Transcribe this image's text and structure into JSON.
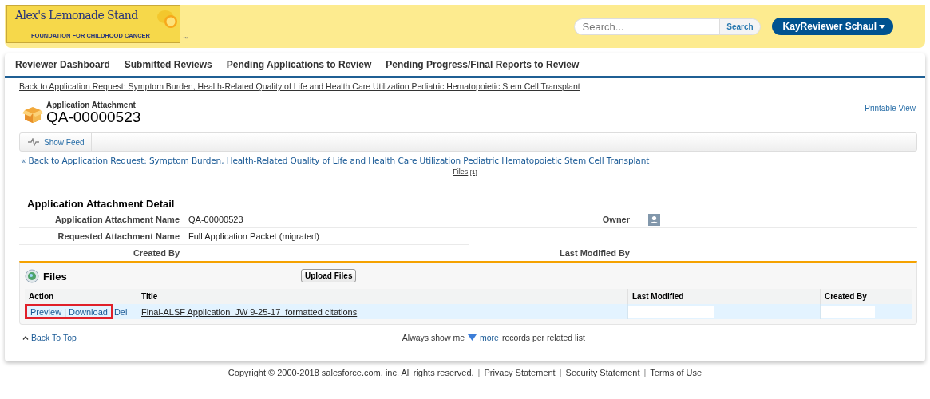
{
  "header": {
    "logo": {
      "title": "Alex's Lemonade Stand",
      "subtitle": "FOUNDATION FOR CHILDHOOD CANCER",
      "mark": "™"
    },
    "search": {
      "placeholder": "Search...",
      "button": "Search"
    },
    "user_menu": "KayReviewer Schaul"
  },
  "nav_tabs": [
    {
      "label": "Reviewer Dashboard",
      "selected": false
    },
    {
      "label": "Submitted Reviews",
      "selected": false
    },
    {
      "label": "Pending Applications to Review",
      "selected": false
    },
    {
      "label": "Pending Progress/Final Reports to Review",
      "selected": false
    }
  ],
  "back_link_top": "Back to Application Request: Symptom Burden, Health-Related Quality of Life and Health Care Utilization Pediatric Hematopoietic Stem Cell Transplant",
  "record": {
    "type": "Application Attachment",
    "name": "QA-00000523",
    "printable_view": "Printable View"
  },
  "feed_button": "Show Feed",
  "back_link": "« Back to Application Request: Symptom Burden, Health-Related Quality of Life and Health Care Utilization Pediatric Hematopoietic Stem Cell Transplant",
  "related_links": [
    {
      "label": "Files",
      "count": "[1]"
    }
  ],
  "detail": {
    "title": "Application Attachment Detail",
    "fields": [
      {
        "label": "Application Attachment Name",
        "value": "QA-00000523",
        "label_2": "Owner",
        "kind": "owner"
      },
      {
        "label": "Requested Attachment Name",
        "value": "Full Application Packet (migrated)",
        "kind": "plain"
      },
      {
        "label": "Created By",
        "label_2": "Last Modified By",
        "kind": "pair"
      }
    ]
  },
  "files": {
    "title": "Files",
    "upload_button": "Upload Files",
    "columns": [
      "Action",
      "Title",
      "Last Modified",
      "Created By"
    ],
    "rows": [
      {
        "preview": "Preview",
        "separator": "|",
        "download": "Download",
        "delete": "Del",
        "title": "Final-ALSF Application  JW 9-25-17  formatted citations",
        "highlighted": true
      }
    ]
  },
  "back_to_top": "Back To Top",
  "records_pref": {
    "before": "Always show me",
    "link": "more",
    "after": "records per related list"
  },
  "footer": {
    "copyright": "Copyright © 2000-2018 salesforce.com, inc. All rights reserved.",
    "links": [
      "Privacy Statement",
      "Security Statement",
      "Terms of Use"
    ],
    "separators": [
      "|",
      "|",
      "|"
    ]
  }
}
